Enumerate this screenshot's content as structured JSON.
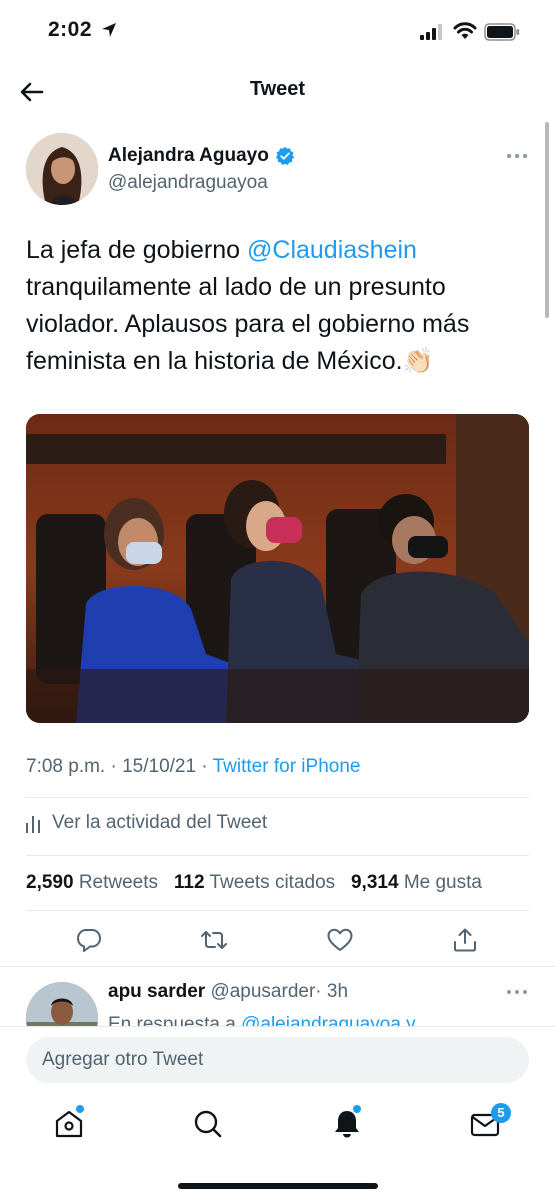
{
  "status_bar": {
    "time": "2:02"
  },
  "header": {
    "title": "Tweet"
  },
  "author": {
    "name": "Alejandra Aguayo",
    "handle": "@alejandraguayoa"
  },
  "tweet": {
    "text_part1": "La jefa de gobierno ",
    "mention": "@Claudiashein",
    "text_part2": " tranquilamente al lado de un presunto violador. Aplausos para el gobierno más feminista en la historia de México.",
    "emoji": "👏🏻"
  },
  "meta": {
    "time": "7:08 p.m.",
    "sep1": " · ",
    "date": "15/10/21",
    "sep2": " · ",
    "source": "Twitter for iPhone"
  },
  "activity": {
    "label": "Ver la actividad del Tweet"
  },
  "stats": {
    "retweets_count": "2,590",
    "retweets_label": "Retweets",
    "quotes_count": "112",
    "quotes_label": "Tweets citados",
    "likes_count": "9,314",
    "likes_label": "Me gusta"
  },
  "reply": {
    "name": "apu sarder",
    "handle": "@apusarder",
    "time": "· 3h",
    "context_prefix": "En respuesta a ",
    "context_mention": "@alejandraguayoa y"
  },
  "compose": {
    "placeholder": "Agregar otro Tweet"
  },
  "tabs": {
    "messages_badge": "5"
  },
  "icons": [
    "location-arrow-icon",
    "signal-icon",
    "wifi-icon",
    "battery-icon",
    "back-arrow-icon",
    "verified-icon",
    "more-icon",
    "activity-chart-icon",
    "reply-icon",
    "retweet-icon",
    "like-icon",
    "share-icon",
    "home-icon",
    "search-icon",
    "notifications-icon",
    "messages-icon"
  ],
  "colors": {
    "accent": "#1d9bf0",
    "text": "#0f1419",
    "secondary": "#536471"
  }
}
